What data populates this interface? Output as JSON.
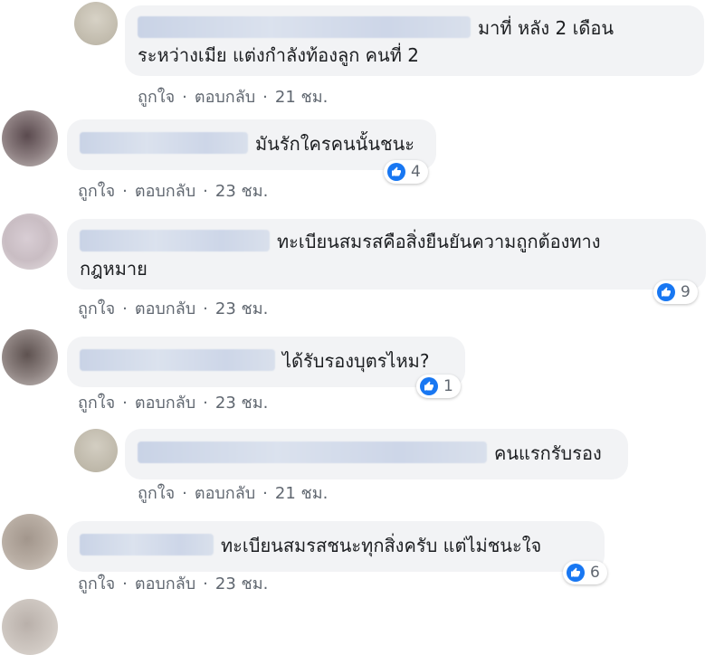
{
  "comments": [
    {
      "lines": [
        "มาที่ หลัง 2 เดือน",
        "ระหว่างเมีย แต่งกำลังท้องลูก คนที่ 2"
      ],
      "like_label": "ถูกใจ",
      "reply_label": "ตอบกลับ",
      "time": "21 ชม.",
      "reactions": null
    },
    {
      "lines": [
        "มันรักใครคนนั้นชนะ"
      ],
      "like_label": "ถูกใจ",
      "reply_label": "ตอบกลับ",
      "time": "23 ชม.",
      "reactions": "4"
    },
    {
      "lines": [
        "ทะเบียนสมรสคือสิ่งยืนยันความถูกต้องทาง",
        "กฎหมาย"
      ],
      "like_label": "ถูกใจ",
      "reply_label": "ตอบกลับ",
      "time": "23 ชม.",
      "reactions": "9"
    },
    {
      "lines": [
        "ได้รับรองบุตรไหม?"
      ],
      "like_label": "ถูกใจ",
      "reply_label": "ตอบกลับ",
      "time": "23 ชม.",
      "reactions": "1"
    },
    {
      "lines": [
        "คนแรกรับรอง"
      ],
      "like_label": "ถูกใจ",
      "reply_label": "ตอบกลับ",
      "time": "21 ชม.",
      "reactions": null
    },
    {
      "lines": [
        "ทะเบียนสมรสชนะทุกสิ่งครับ แต่ไม่ชนะใจ"
      ],
      "like_label": "ถูกใจ",
      "reply_label": "ตอบกลับ",
      "time": "23 ชม.",
      "reactions": "6"
    }
  ],
  "colors": {
    "bubble": "#f2f3f5",
    "meta_text": "#606770",
    "like_blue": "#1877f2"
  },
  "icons": {
    "reaction": "thumbs-up-icon"
  }
}
